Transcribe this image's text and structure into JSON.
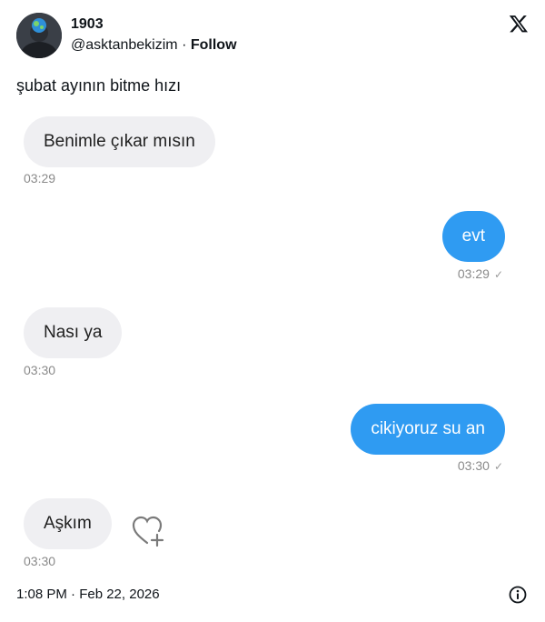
{
  "post": {
    "author_name": "1903",
    "handle": "@asktanbekizim",
    "separator": "·",
    "follow_label": "Follow",
    "text": "şubat ayının bitme hızı",
    "posted_at": "1:08 PM · Feb 22, 2026"
  },
  "icons": {
    "x_logo": "x-logo-icon",
    "heart_add": "heart-add-icon",
    "info": "info-icon",
    "read_check": "checkmark-icon"
  },
  "chat": {
    "messages": [
      {
        "direction": "incoming",
        "text": "Benimle çıkar mısın",
        "time": "03:29"
      },
      {
        "direction": "outgoing",
        "text": "evt",
        "time": "03:29",
        "check": "✓"
      },
      {
        "direction": "incoming",
        "text": "Nası ya",
        "time": "03:30"
      },
      {
        "direction": "outgoing",
        "text": "cikiyoruz su an",
        "time": "03:30",
        "check": "✓"
      },
      {
        "direction": "incoming",
        "text": "Aşkım",
        "time": "03:30"
      }
    ]
  },
  "colors": {
    "outgoing_bubble": "#2f9bf2",
    "incoming_bubble": "#efeff2",
    "timestamp": "#8a8a8a"
  }
}
